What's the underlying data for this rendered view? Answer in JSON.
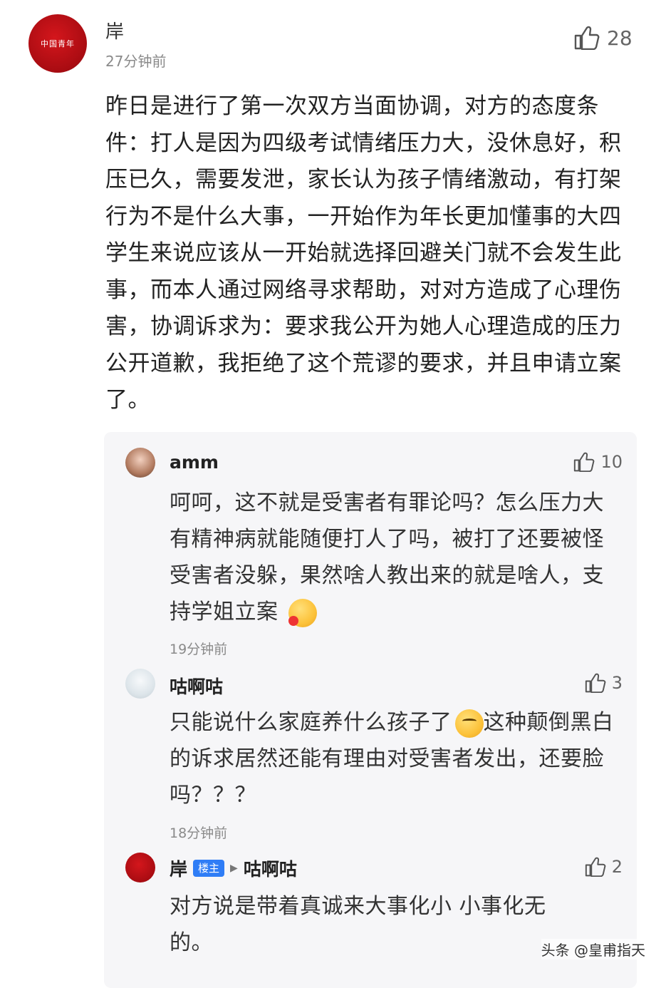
{
  "main_comment": {
    "avatar_text": "中国青年",
    "author": "岸",
    "time": "27分钟前",
    "likes": "28",
    "text": "昨日是进行了第一次双方当面协调，对方的态度条件：打人是因为四级考试情绪压力大，没休息好，积压已久，需要发泄，家长认为孩子情绪激动，有打架行为不是什么大事，一开始作为年长更加懂事的大四学生来说应该从一开始就选择回避关门就不会发生此事，而本人通过网络寻求帮助，对对方造成了心理伤害，协调诉求为：要求我公开为她人心理造成的压力公开道歉，我拒绝了这个荒谬的要求，并且申请立案了。"
  },
  "replies": [
    {
      "author": "amm",
      "likes": "10",
      "text": "呵呵，这不就是受害者有罪论吗？怎么压力大有精神病就能随便打人了吗，被打了还要被怪受害者没躲，果然啥人教出来的就是啥人，支持学姐立案",
      "time": "19分钟前"
    },
    {
      "author": "咕啊咕",
      "likes": "3",
      "text_before_emoji": "只能说什么家庭养什么孩子了",
      "text_after_emoji": "这种颠倒黑白的诉求居然还能有理由对受害者发出，还要脸吗？？？",
      "time": "18分钟前"
    },
    {
      "author": "岸",
      "badge": "楼主",
      "reply_to": "咕啊咕",
      "likes": "2",
      "text": "对方说是带着真诚来大事化小 小事化无的。"
    }
  ],
  "watermark": "头条 @皇甫指天"
}
